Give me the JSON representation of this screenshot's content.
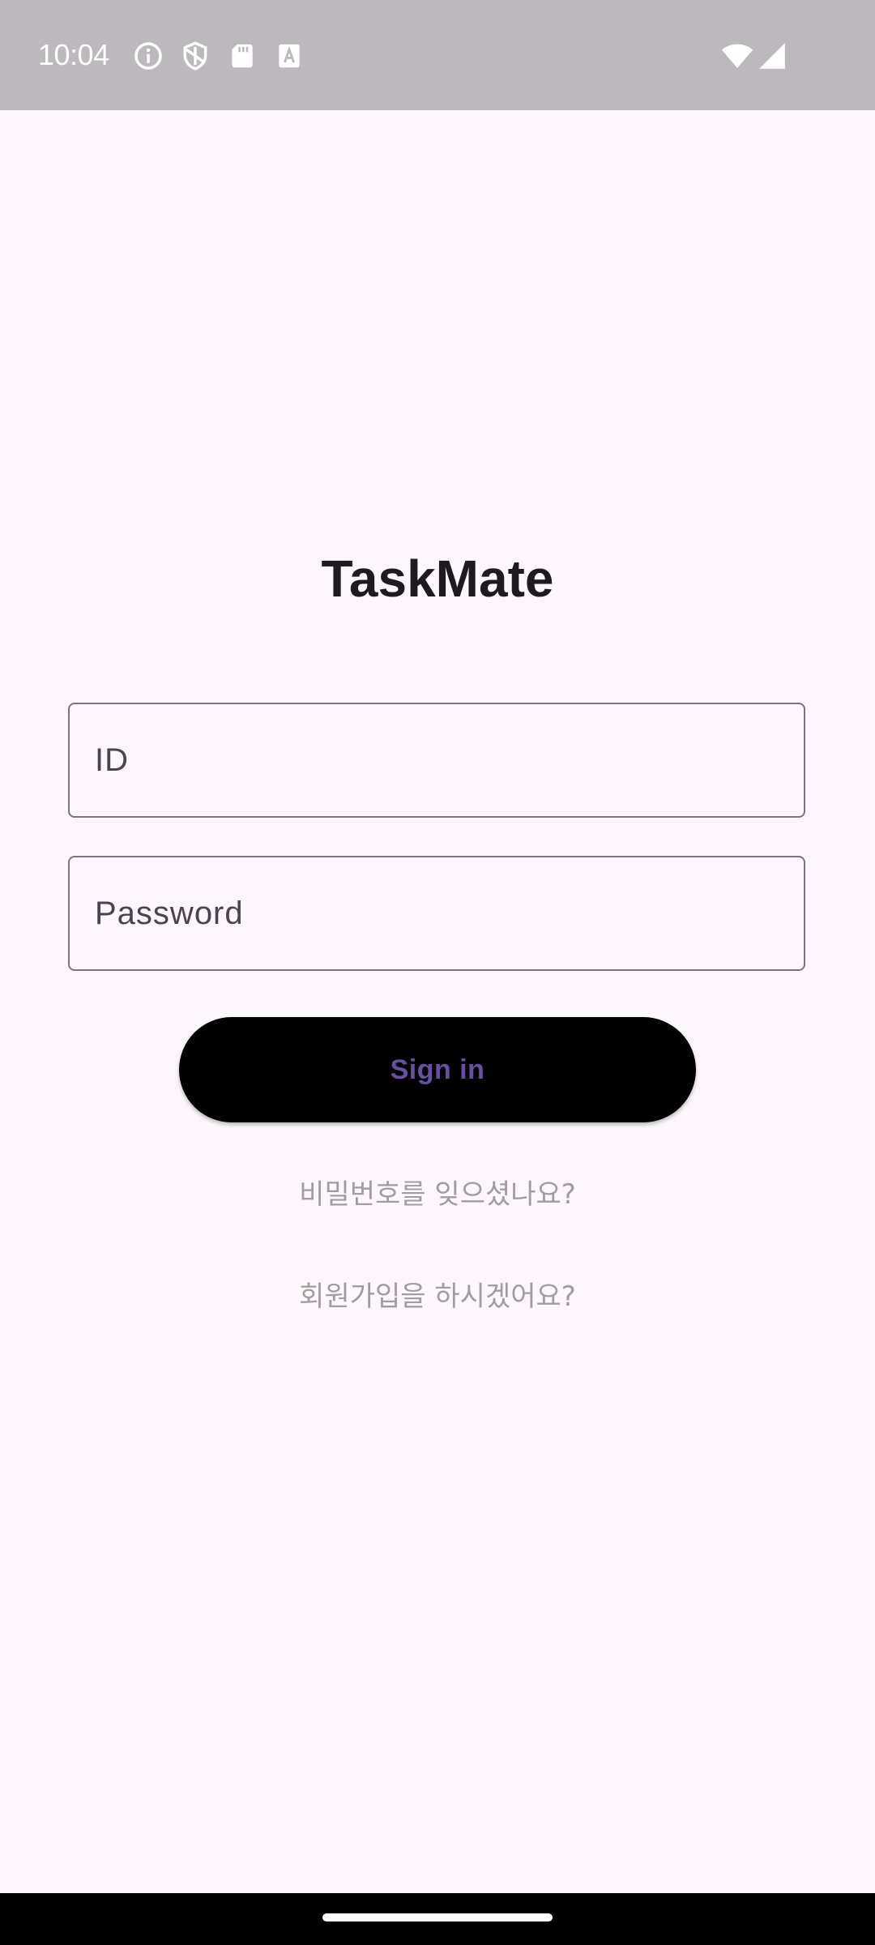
{
  "status_bar": {
    "time": "10:04",
    "left_icons": [
      "info-icon",
      "shield-icon",
      "sd-card-icon",
      "font-download-icon"
    ],
    "right_icons": [
      "wifi-icon",
      "cellular-signal-icon"
    ],
    "background_color": "#bcb8bd"
  },
  "login": {
    "app_title": "TaskMate",
    "id_placeholder": "ID",
    "password_placeholder": "Password",
    "sign_in_label": "Sign in",
    "forgot_password_link": "비밀번호를 잊으셨나요?",
    "signup_link": "회원가입을 하시겠어요?"
  },
  "colors": {
    "background": "#fdf7fd",
    "button_background": "#000000",
    "button_text": "#6750a4",
    "link_text": "#9e9e9e",
    "field_border": "#79747e"
  }
}
